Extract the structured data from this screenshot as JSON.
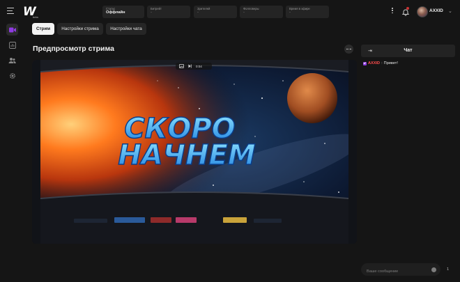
{
  "app": {
    "logo_text": "W",
    "logo_sub": "beta"
  },
  "stats": [
    {
      "label": "Статус",
      "value": "Оффлайн",
      "dim": false
    },
    {
      "label": "Битрейт",
      "value": "-",
      "dim": true
    },
    {
      "label": "Зрителей",
      "value": "-",
      "dim": true
    },
    {
      "label": "Фолловеры",
      "value": "-",
      "dim": true
    },
    {
      "label": "Время в эфире",
      "value": "-",
      "dim": true
    }
  ],
  "user": {
    "name": "AXXID"
  },
  "sidebar": {
    "items": [
      "video-icon",
      "stats-icon",
      "users-icon",
      "settings-icon"
    ],
    "active": 0,
    "accent": "#8e3be0"
  },
  "tabs": [
    {
      "label": "Стрим",
      "active": true
    },
    {
      "label": "Настройки стрима",
      "active": false
    },
    {
      "label": "Настройки чата",
      "active": false
    }
  ],
  "main": {
    "title": "Предпросмотр стрима"
  },
  "preview": {
    "headline_line1": "СКОРО",
    "headline_line2": "НАЧНЕМ",
    "control_text": "0:04"
  },
  "chat": {
    "title": "Чат",
    "messages": [
      {
        "author": "AXXID",
        "text": "Привет!"
      }
    ],
    "input_placeholder": "Ваше сообщение",
    "send_label": "1"
  }
}
